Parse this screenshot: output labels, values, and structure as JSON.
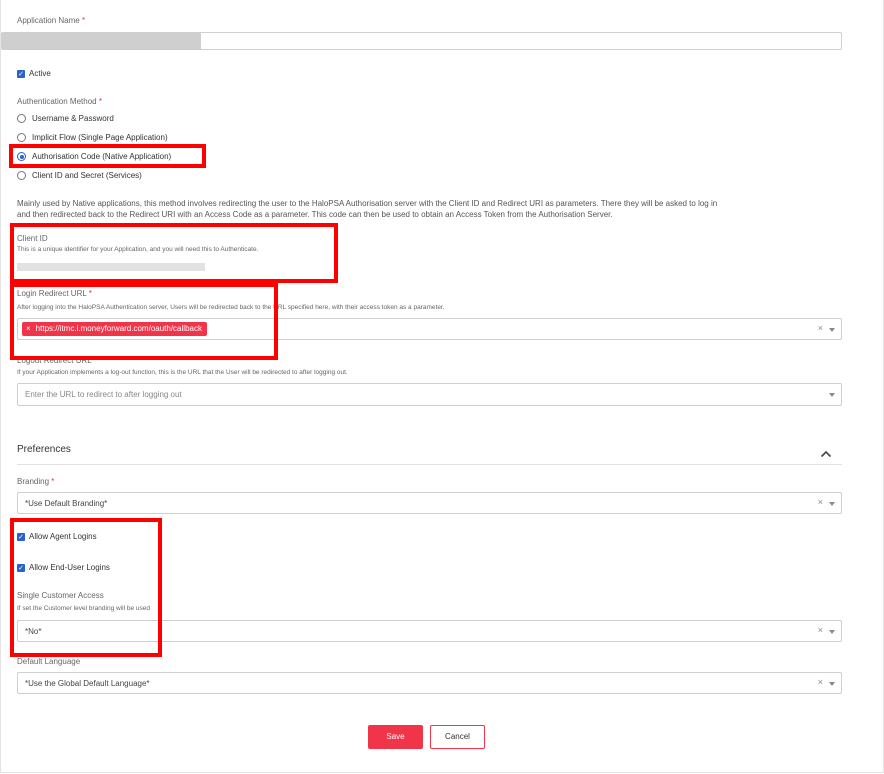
{
  "form": {
    "app_name": {
      "label": "Application Name",
      "required_mark": "*",
      "value": ""
    },
    "active": {
      "label": "Active",
      "checked": true
    },
    "auth_method": {
      "label": "Authentication Method",
      "required_mark": "*",
      "options": [
        {
          "label": "Username & Password",
          "selected": false
        },
        {
          "label": "Implicit Flow (Single Page Application)",
          "selected": false
        },
        {
          "label": "Authorisation Code (Native Application)",
          "selected": true
        },
        {
          "label": "Client ID and Secret (Services)",
          "selected": false
        }
      ],
      "description_line1": "Mainly used by Native applications, this method involves redirecting the user to the HaloPSA Authorisation server with the Client ID and Redirect URI as parameters. There they will be asked to log in",
      "description_line2": "and then redirected back to the Redirect URI with an Access Code as a parameter. This code can then be used to obtain an Access Token from the Authorisation Server."
    },
    "client_id": {
      "label": "Client ID",
      "hint": "This is a unique identifier for your Application, and you will need this to Authenticate."
    },
    "login_redirect": {
      "label": "Login Redirect URL",
      "required_mark": "*",
      "hint": "After logging into the HaloPSA Authentication server, Users will be redirected back to the URL specified here, with their access token as a parameter.",
      "tags": [
        "https://itmc.i.moneyforward.com/oauth/callback"
      ],
      "tag_remove": "×",
      "clear": "×"
    },
    "logout_redirect": {
      "label": "Logout Redirect URL",
      "hint": "If your Application implements a log-out function, this is the URL that the User will be redirected to after logging out.",
      "placeholder": "Enter the URL to redirect to after logging out"
    }
  },
  "preferences": {
    "title": "Preferences",
    "branding": {
      "label": "Branding",
      "required_mark": "*",
      "value": "*Use Default Branding*",
      "clear": "×"
    },
    "allow_agent": {
      "label": "Allow Agent Logins",
      "checked": true
    },
    "allow_enduser": {
      "label": "Allow End-User Logins",
      "checked": true
    },
    "single_customer": {
      "label": "Single Customer Access",
      "hint": "If set the Customer level branding will be used",
      "value": "*No*",
      "clear": "×"
    },
    "default_language": {
      "label": "Default Language",
      "value": "*Use the Global Default Language*",
      "clear": "×"
    }
  },
  "actions": {
    "save": "Save",
    "cancel": "Cancel"
  },
  "colors": {
    "accent_red": "#f0354a",
    "highlight": "#ff0000",
    "checkbox_blue": "#2a63c8"
  },
  "icons": {
    "checkbox": "check-icon",
    "collapse": "chevron-up-icon",
    "dropdown": "caret-down-icon",
    "clear": "close-icon"
  }
}
